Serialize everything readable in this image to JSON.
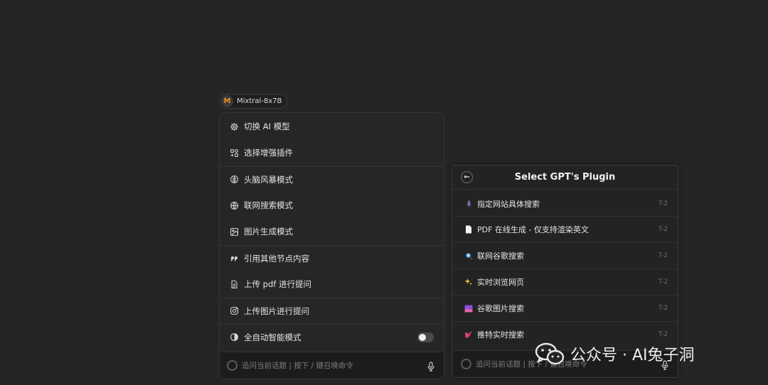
{
  "model_selector": {
    "logo_letter": "M",
    "name": "Mixtral-8x7B",
    "logo_color": "#f28a1b"
  },
  "command_menu": {
    "items": [
      {
        "icon": "gear-icon",
        "label": "切换 AI 模型"
      },
      {
        "icon": "plugin-grid-icon",
        "label": "选择增强插件"
      },
      {
        "icon": "brain-icon",
        "label": "头脑风暴模式"
      },
      {
        "icon": "globe-icon",
        "label": "联网搜索模式"
      },
      {
        "icon": "image-icon",
        "label": "图片生成模式"
      },
      {
        "icon": "quote-icon",
        "label": "引用其他节点内容"
      },
      {
        "icon": "document-icon",
        "label": "上传 pdf 进行提问"
      },
      {
        "icon": "instagram-icon",
        "label": "上传图片进行提问"
      },
      {
        "icon": "half-circle-icon",
        "label": "全自动智能模式",
        "toggle": false
      }
    ],
    "input_placeholder": "追问当前话题 | 按下 / 键召唤命令"
  },
  "plugin_panel": {
    "title": "Select GPT's Plugin",
    "back_icon": "arrow-left-icon",
    "items": [
      {
        "icon": "spider-emoji-icon",
        "label": "指定网站具体搜索",
        "shortcut": "T-2"
      },
      {
        "icon": "page-emoji-icon",
        "label": "PDF 在线生成 - 仅支持渲染英文",
        "shortcut": "T-2"
      },
      {
        "icon": "magnifier-emoji-icon",
        "label": "联网谷歌搜索",
        "shortcut": "T-2"
      },
      {
        "icon": "sparkles-emoji-icon",
        "label": "实时浏览网页",
        "shortcut": "T-2"
      },
      {
        "icon": "picture-emoji-icon",
        "label": "谷歌图片搜索",
        "shortcut": "T-2"
      },
      {
        "icon": "bird-emoji-icon",
        "label": "推特实时搜索",
        "shortcut": "T-2"
      }
    ],
    "input_placeholder": "追问当前话题 | 按下 / 键召唤命令"
  },
  "watermark": {
    "text": "公众号 · AI兔子洞",
    "icon": "wechat-icon"
  }
}
